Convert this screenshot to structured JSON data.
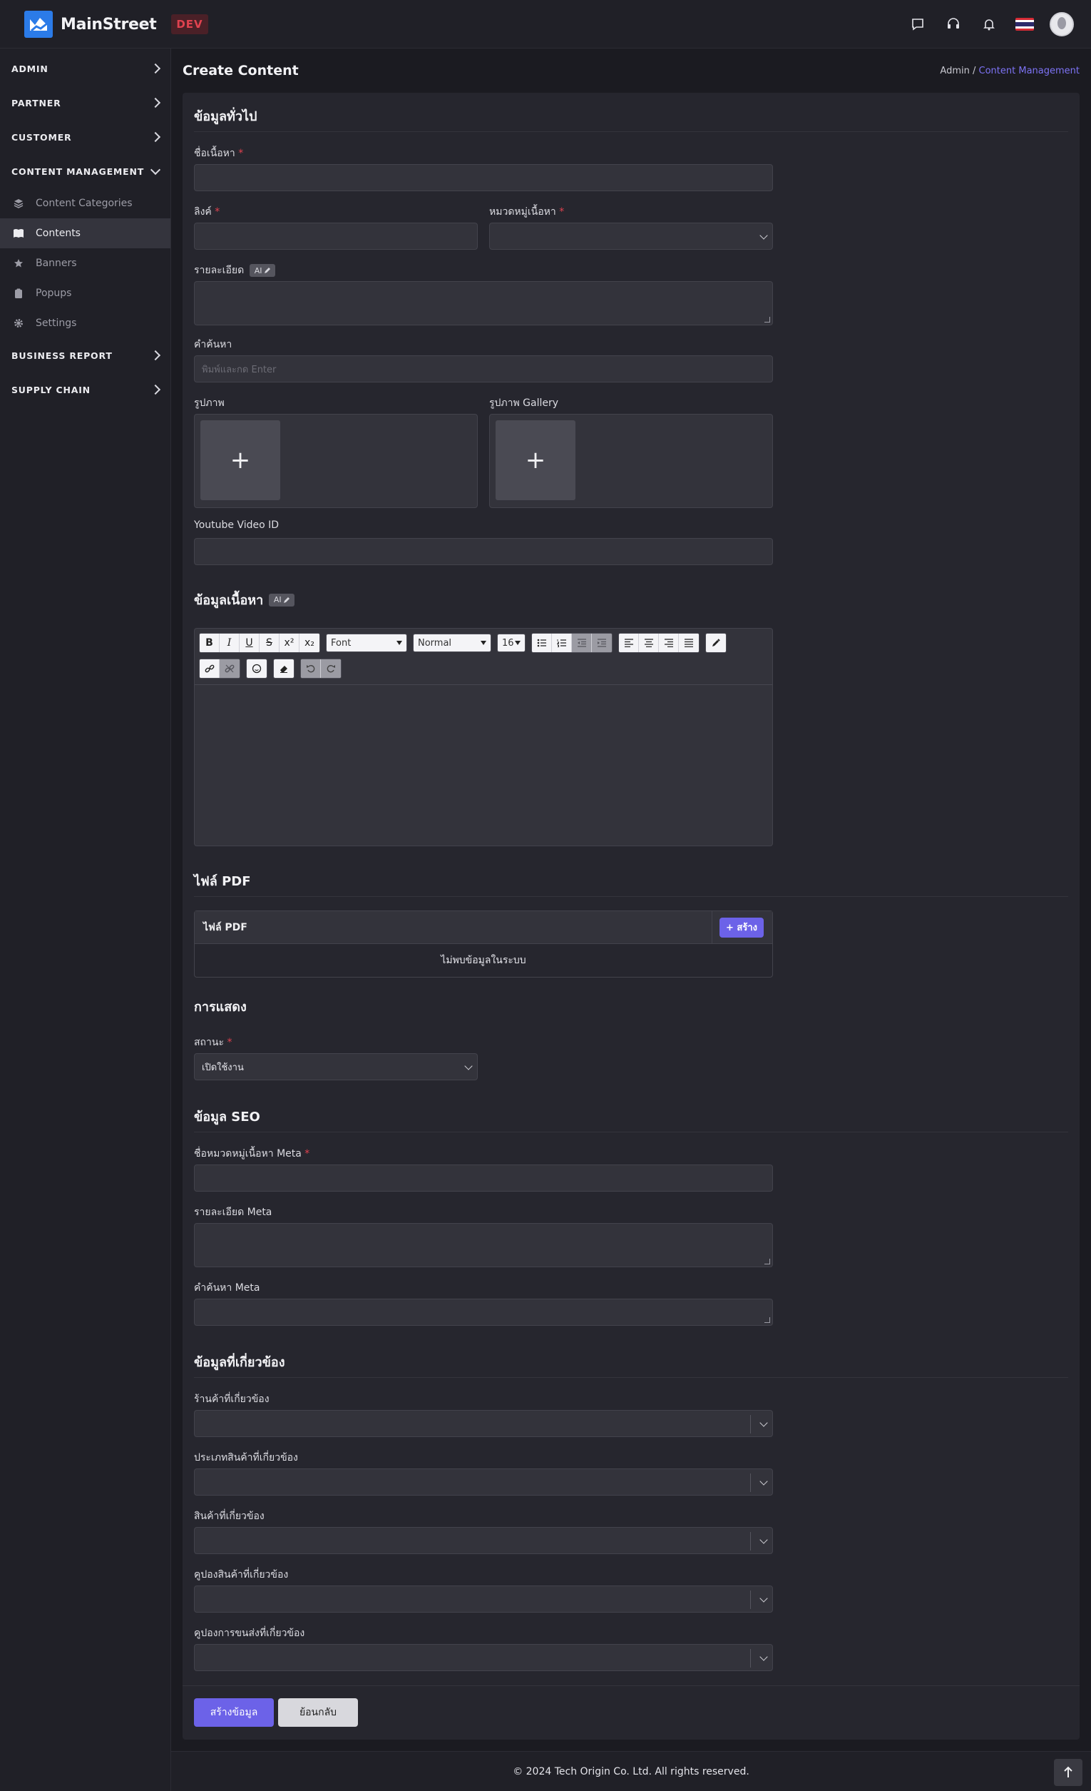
{
  "app": {
    "brand": "MainStreet",
    "env_badge": "DEV"
  },
  "sidebar": {
    "groups": [
      {
        "label": "ADMIN"
      },
      {
        "label": "PARTNER"
      },
      {
        "label": "CUSTOMER"
      },
      {
        "label": "CONTENT MANAGEMENT"
      },
      {
        "label": "BUSINESS REPORT"
      },
      {
        "label": "SUPPLY CHAIN"
      }
    ],
    "content_items": [
      {
        "label": "Content Categories"
      },
      {
        "label": "Contents"
      },
      {
        "label": "Banners"
      },
      {
        "label": "Popups"
      },
      {
        "label": "Settings"
      }
    ]
  },
  "header": {
    "title": "Create Content",
    "breadcrumb_root": "Admin",
    "breadcrumb_sep": " / ",
    "breadcrumb_current": "Content Management"
  },
  "general": {
    "title": "ข้อมูลทั่วไป",
    "name_label": "ชื่อเนื้อหา",
    "link_label": "ลิงค์",
    "category_label": "หมวดหมู่เนื้อหา",
    "description_label": "รายละเอียด",
    "ai_badge": "AI",
    "keywords_label": "คำค้นหา",
    "keywords_placeholder": "พิมพ์และกด Enter",
    "image_label": "รูปภาพ",
    "gallery_label": "รูปภาพ Gallery",
    "upload_plus": "+",
    "youtube_label": "Youtube Video ID",
    "required_mark": "*"
  },
  "content_info": {
    "title": "ข้อมูลเนื้อหา",
    "ai_badge": "AI",
    "toolbar": {
      "bold": "B",
      "italic": "I",
      "underline": "U",
      "strike": "S",
      "superscript": "x²",
      "subscript": "x₂",
      "font": "Font",
      "style": "Normal",
      "size": "16"
    }
  },
  "pdf": {
    "title": "ไฟล์ PDF",
    "table_header": "ไฟล์ PDF",
    "add_button": "+ สร้าง",
    "empty_text": "ไม่พบข้อมูลในระบบ"
  },
  "display": {
    "title": "การแสดง",
    "status_label": "สถานะ",
    "status_value": "เปิดใช้งาน"
  },
  "seo": {
    "title": "ข้อมูล SEO",
    "meta_title_label": "ชื่อหมวดหมู่เนื้อหา Meta",
    "meta_desc_label": "รายละเอียด Meta",
    "meta_keywords_label": "คำค้นหา Meta"
  },
  "related": {
    "title": "ข้อมูลที่เกี่ยวข้อง",
    "fields": [
      {
        "label": "ร้านค้าที่เกี่ยวข้อง"
      },
      {
        "label": "ประเภทสินค้าที่เกี่ยวข้อง"
      },
      {
        "label": "สินค้าที่เกี่ยวข้อง"
      },
      {
        "label": "คูปองสินค้าที่เกี่ยวข้อง"
      },
      {
        "label": "คูปองการขนส่งที่เกี่ยวข้อง"
      }
    ]
  },
  "actions": {
    "create": "สร้างข้อมูล",
    "back": "ย้อนกลับ"
  },
  "footer": {
    "copyright": "© 2024 Tech Origin Co. Ltd. All rights reserved."
  },
  "colors": {
    "accent": "#6c62e8",
    "brand": "#2b7be8",
    "required": "#e0424f",
    "background": "#1b1b21"
  }
}
